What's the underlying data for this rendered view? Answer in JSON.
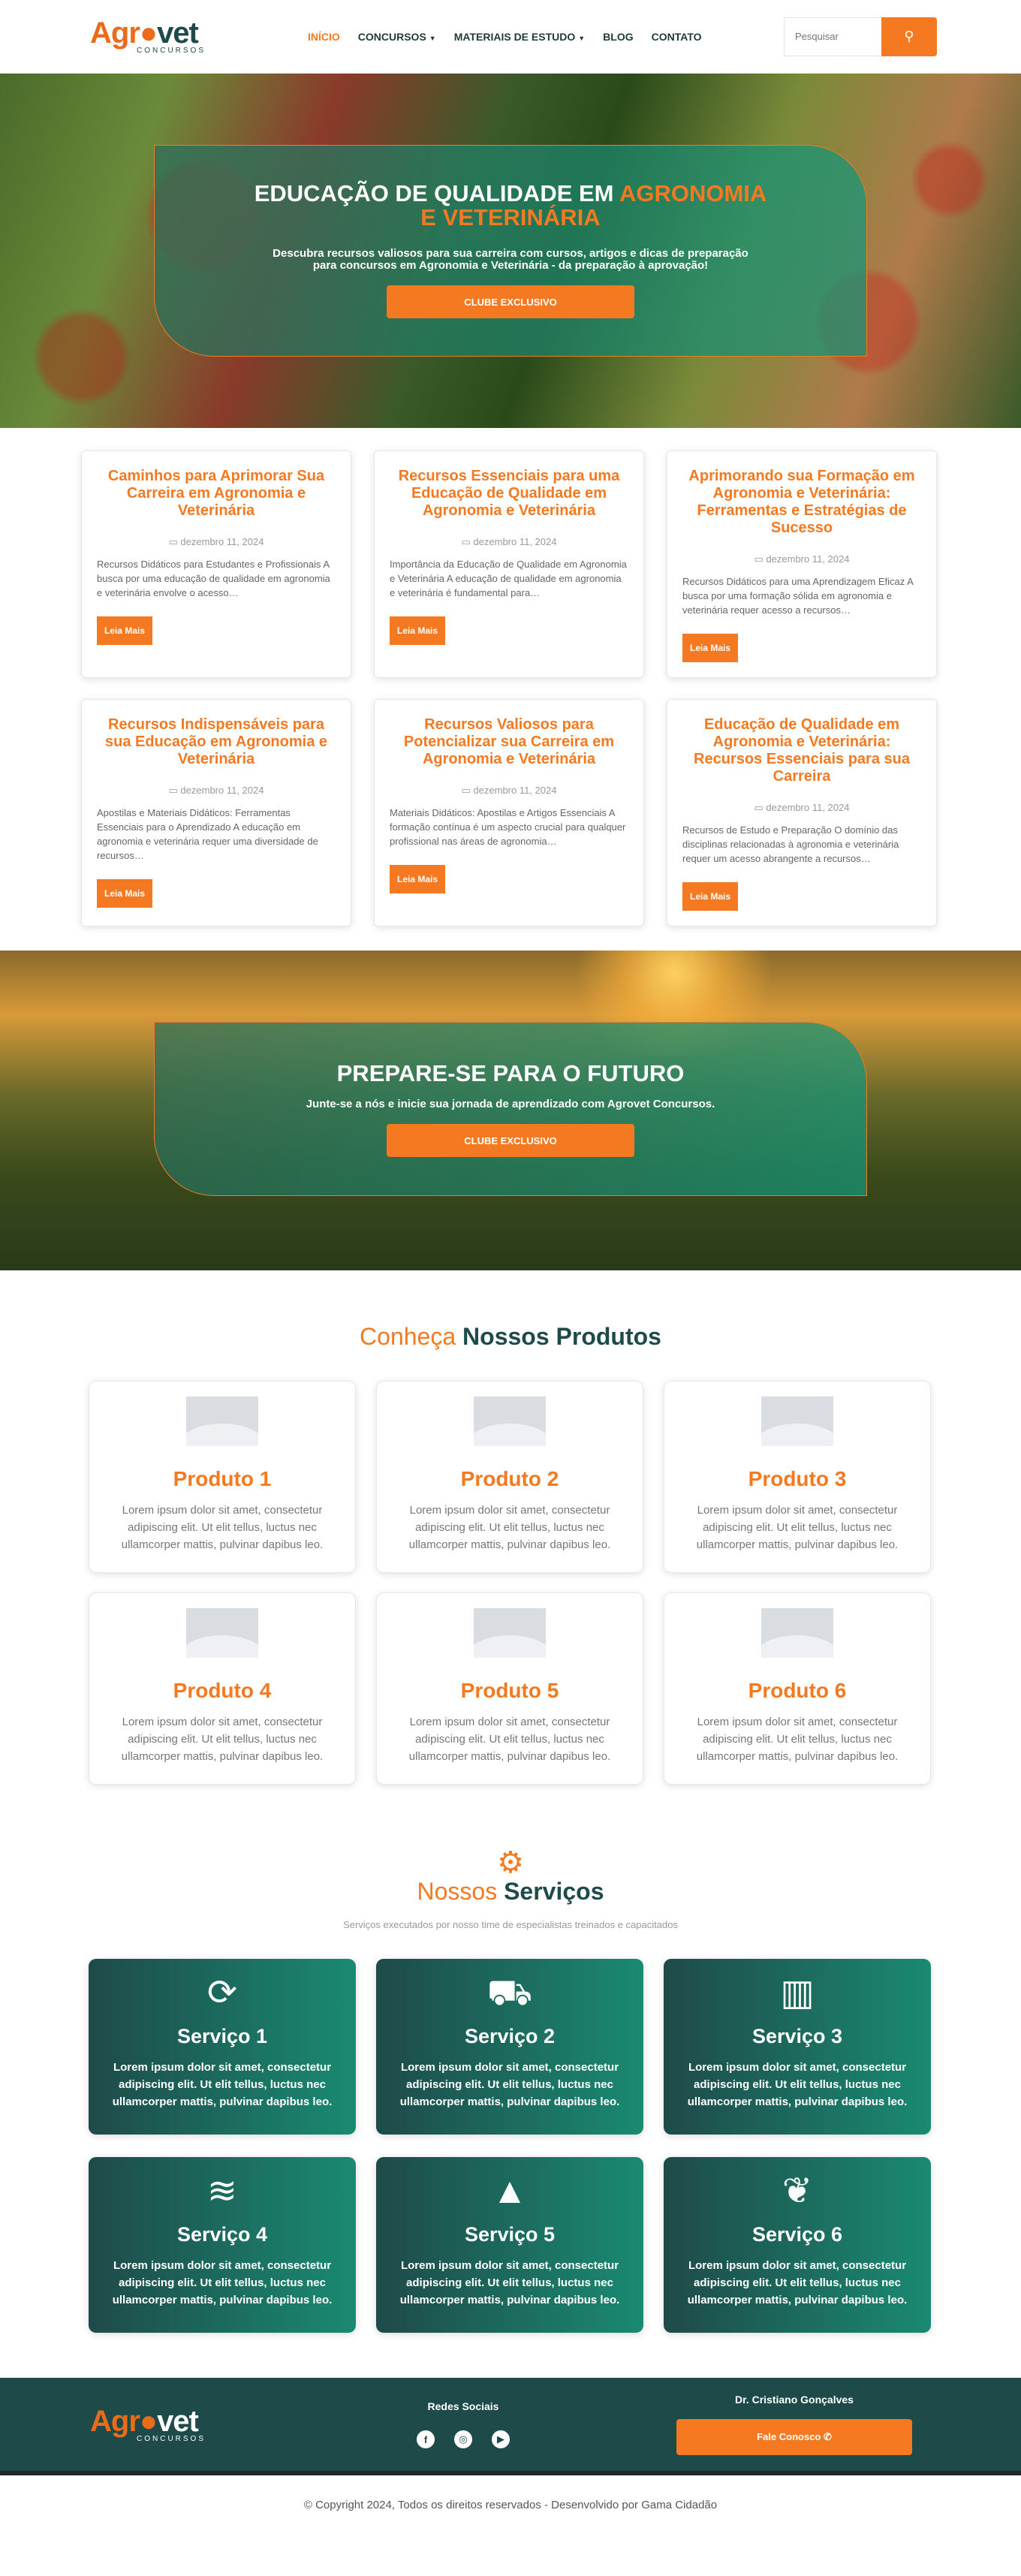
{
  "header": {
    "logo": {
      "part1": "Agr",
      "part2": "vet",
      "sub": "CONCURSOS"
    },
    "nav": [
      {
        "label": "INÍCIO",
        "active": true,
        "dropdown": false
      },
      {
        "label": "CONCURSOS",
        "active": false,
        "dropdown": true
      },
      {
        "label": "MATERIAIS DE ESTUDO",
        "active": false,
        "dropdown": true
      },
      {
        "label": "BLOG",
        "active": false,
        "dropdown": false
      },
      {
        "label": "CONTATO",
        "active": false,
        "dropdown": false
      }
    ],
    "search_placeholder": "Pesquisar"
  },
  "hero": {
    "title_main": "EDUCAÇÃO DE QUALIDADE EM ",
    "title_accent": "AGRONOMIA E VETERINÁRIA",
    "description": "Descubra recursos valiosos para sua carreira com cursos, artigos e dicas de preparação para concursos em Agronomia e Veterinária - da preparação à aprovação!",
    "cta": "CLUBE EXCLUSIVO"
  },
  "posts": [
    {
      "title": "Caminhos para Aprimorar Sua Carreira em Agronomia e Veterinária",
      "date": "dezembro 11, 2024",
      "excerpt": "Recursos Didáticos para Estudantes e Profissionais A busca por uma educação de qualidade em agronomia e veterinária envolve o acesso…",
      "button": "Leia Mais"
    },
    {
      "title": "Recursos Essenciais para uma Educação de Qualidade em Agronomia e Veterinária",
      "date": "dezembro 11, 2024",
      "excerpt": "Importância da Educação de Qualidade em Agronomia e Veterinária A educação de qualidade em agronomia e veterinária é fundamental para…",
      "button": "Leia Mais"
    },
    {
      "title": "Aprimorando sua Formação em Agronomia e Veterinária: Ferramentas e Estratégias de Sucesso",
      "date": "dezembro 11, 2024",
      "excerpt": "Recursos Didáticos para uma Aprendizagem Eficaz A busca por uma formação sólida em agronomia e veterinária requer acesso a recursos…",
      "button": "Leia Mais"
    },
    {
      "title": "Recursos Indispensáveis para sua Educação em Agronomia e Veterinária",
      "date": "dezembro 11, 2024",
      "excerpt": "Apostilas e Materiais Didáticos: Ferramentas Essenciais para o Aprendizado A educação em agronomia e veterinária requer uma diversidade de recursos…",
      "button": "Leia Mais"
    },
    {
      "title": "Recursos Valiosos para Potencializar sua Carreira em Agronomia e Veterinária",
      "date": "dezembro 11, 2024",
      "excerpt": "Materiais Didáticos: Apostilas e Artigos Essenciais A formação contínua é um aspecto crucial para qualquer profissional nas áreas de agronomia…",
      "button": "Leia Mais"
    },
    {
      "title": "Educação de Qualidade em Agronomia e Veterinária: Recursos Essenciais para sua Carreira",
      "date": "dezembro 11, 2024",
      "excerpt": "Recursos de Estudo e Preparação O domínio das disciplinas relacionadas à agronomia e veterinária requer um acesso abrangente a recursos…",
      "button": "Leia Mais"
    }
  ],
  "future": {
    "title": "PREPARE-SE PARA O FUTURO",
    "description": "Junte-se a nós e inicie sua jornada de aprendizado com Agrovet Concursos.",
    "cta": "CLUBE EXCLUSIVO"
  },
  "products": {
    "title_light": "Conheça ",
    "title_bold": "Nossos Produtos",
    "items": [
      {
        "title": "Produto 1",
        "desc": "Lorem ipsum dolor sit amet, consectetur adipiscing elit. Ut elit tellus, luctus nec ullamcorper mattis, pulvinar dapibus leo."
      },
      {
        "title": "Produto 2",
        "desc": "Lorem ipsum dolor sit amet, consectetur adipiscing elit. Ut elit tellus, luctus nec ullamcorper mattis, pulvinar dapibus leo."
      },
      {
        "title": "Produto 3",
        "desc": "Lorem ipsum dolor sit amet, consectetur adipiscing elit. Ut elit tellus, luctus nec ullamcorper mattis, pulvinar dapibus leo."
      },
      {
        "title": "Produto 4",
        "desc": "Lorem ipsum dolor sit amet, consectetur adipiscing elit. Ut elit tellus, luctus nec ullamcorper mattis, pulvinar dapibus leo."
      },
      {
        "title": "Produto 5",
        "desc": "Lorem ipsum dolor sit amet, consectetur adipiscing elit. Ut elit tellus, luctus nec ullamcorper mattis, pulvinar dapibus leo."
      },
      {
        "title": "Produto 6",
        "desc": "Lorem ipsum dolor sit amet, consectetur adipiscing elit. Ut elit tellus, luctus nec ullamcorper mattis, pulvinar dapibus leo."
      }
    ]
  },
  "services": {
    "title_light": "Nossos ",
    "title_bold": "Serviços",
    "subtitle": "Serviços executados por nosso time de especialistas treinados e capacitados",
    "items": [
      {
        "icon": "sync-icon",
        "glyph": "⟳",
        "title": "Serviço 1",
        "desc": "Lorem ipsum dolor sit amet, consectetur adipiscing elit. Ut elit tellus, luctus nec ullamcorper mattis, pulvinar dapibus leo."
      },
      {
        "icon": "tractor-icon",
        "glyph": "⛟",
        "title": "Serviço 2",
        "desc": "Lorem ipsum dolor sit amet, consectetur adipiscing elit. Ut elit tellus, luctus nec ullamcorper mattis, pulvinar dapibus leo."
      },
      {
        "icon": "fence-icon",
        "glyph": "▥",
        "title": "Serviço 3",
        "desc": "Lorem ipsum dolor sit amet, consectetur adipiscing elit. Ut elit tellus, luctus nec ullamcorper mattis, pulvinar dapibus leo."
      },
      {
        "icon": "water-icon",
        "glyph": "≋",
        "title": "Serviço 4",
        "desc": "Lorem ipsum dolor sit amet, consectetur adipiscing elit. Ut elit tellus, luctus nec ullamcorper mattis, pulvinar dapibus leo."
      },
      {
        "icon": "tree-icon",
        "glyph": "▲",
        "title": "Serviço 5",
        "desc": "Lorem ipsum dolor sit amet, consectetur adipiscing elit. Ut elit tellus, luctus nec ullamcorper mattis, pulvinar dapibus leo."
      },
      {
        "icon": "leaf-icon",
        "glyph": "❦",
        "title": "Serviço 6",
        "desc": "Lorem ipsum dolor sit amet, consectetur adipiscing elit. Ut elit tellus, luctus nec ullamcorper mattis, pulvinar dapibus leo."
      }
    ]
  },
  "footer": {
    "social_title": "Redes Sociais",
    "socials": [
      {
        "icon": "facebook-icon",
        "glyph": "f"
      },
      {
        "icon": "instagram-icon",
        "glyph": "◎"
      },
      {
        "icon": "youtube-icon",
        "glyph": "▶"
      }
    ],
    "contact_name": "Dr. Cristiano Gonçalves",
    "contact_button": "Fale Conosco",
    "copyright": "© Copyright 2024, Todos os direitos reservados - Desenvolvido por Gama Cidadão"
  },
  "colors": {
    "accent": "#f47920",
    "primary": "#1e4a4a",
    "teal": "#1a8a72"
  }
}
